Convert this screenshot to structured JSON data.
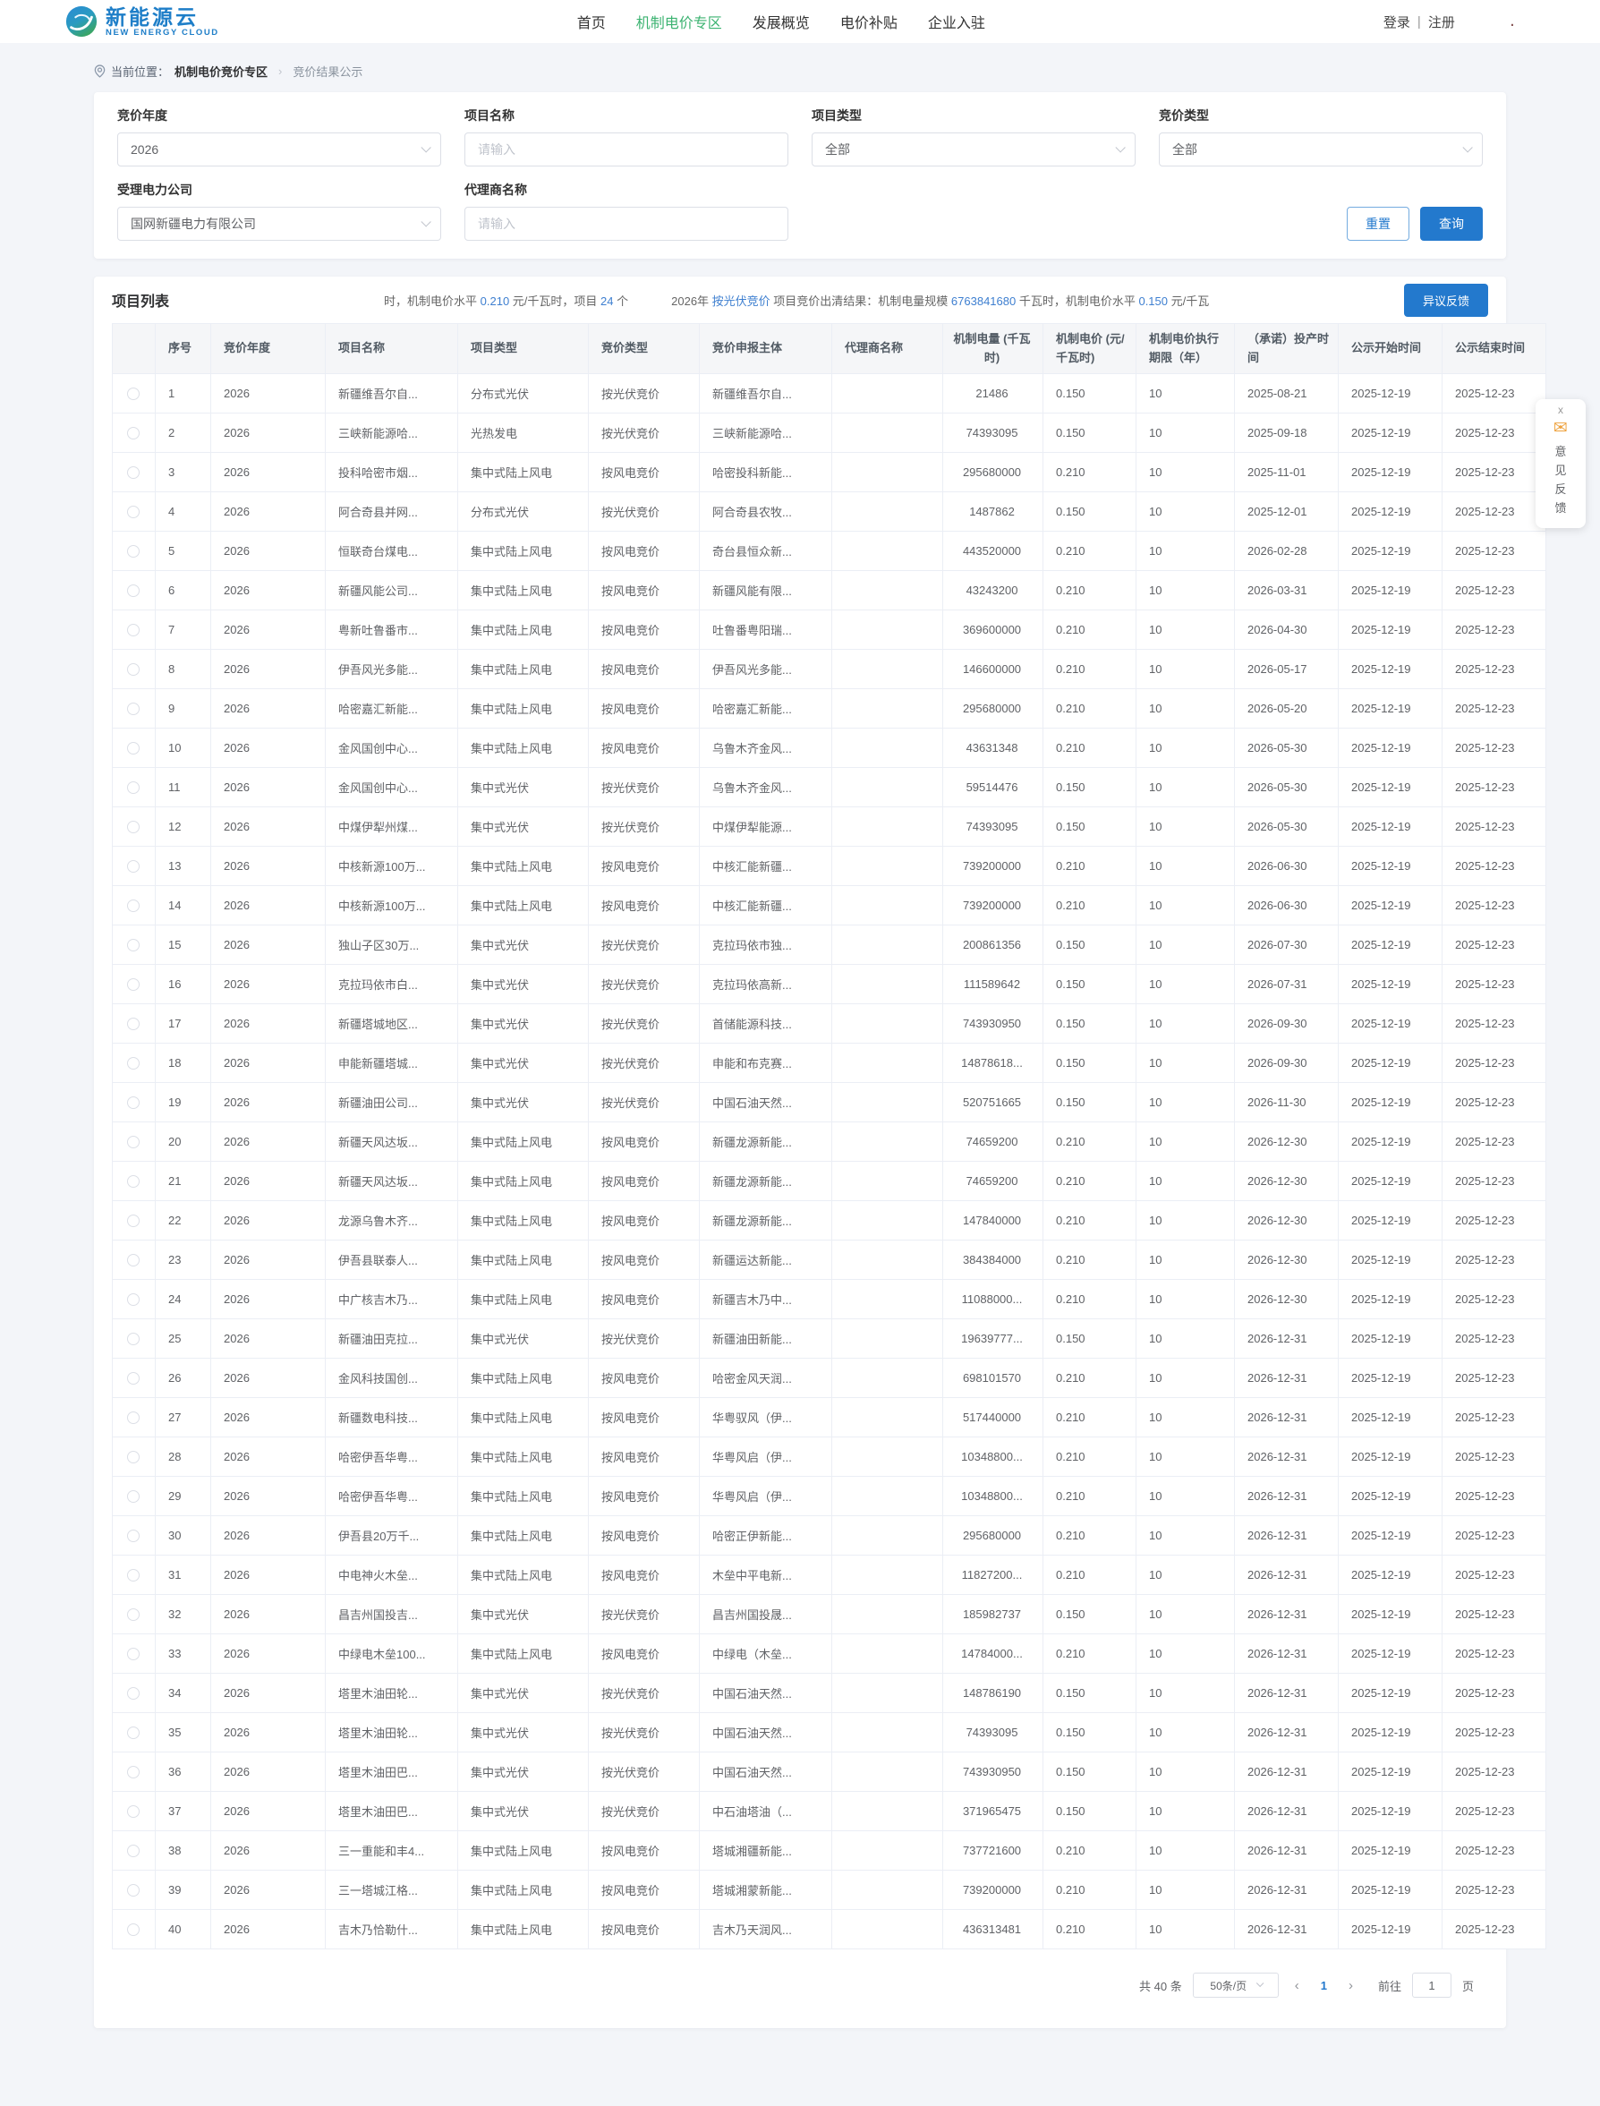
{
  "colors": {
    "accent_blue": "#2379cd",
    "link_blue": "#3e7fd0",
    "active_green": "#3cb371",
    "logo_blue": "#1e7ec8",
    "page_bg": "#f3f5f9"
  },
  "header": {
    "logo_title": "新能源云",
    "logo_subtitle": "NEW ENERGY CLOUD",
    "nav": [
      {
        "key": "home",
        "label": "首页",
        "active": false
      },
      {
        "key": "mechanism-price",
        "label": "机制电价专区",
        "active": true
      },
      {
        "key": "development-overview",
        "label": "发展概览",
        "active": false
      },
      {
        "key": "price-subsidy",
        "label": "电价补贴",
        "active": false
      },
      {
        "key": "enterprise-join",
        "label": "企业入驻",
        "active": false
      }
    ],
    "login_label": "登录",
    "login_divider": "|",
    "register_label": "注册",
    "dot": "."
  },
  "breadcrumb": {
    "label": "当前位置：",
    "root": "机制电价竞价专区",
    "sep": "›",
    "current": "竞价结果公示"
  },
  "filters": {
    "fields": [
      {
        "key": "bidding-year",
        "label": "竞价年度",
        "type": "select",
        "value": "2026"
      },
      {
        "key": "project-name",
        "label": "项目名称",
        "type": "input",
        "value": "",
        "placeholder": "请输入"
      },
      {
        "key": "project-type",
        "label": "项目类型",
        "type": "select",
        "value": "全部"
      },
      {
        "key": "bidding-type",
        "label": "竞价类型",
        "type": "select",
        "value": "全部"
      },
      {
        "key": "power-company",
        "label": "受理电力公司",
        "type": "select",
        "value": "国网新疆电力有限公司"
      },
      {
        "key": "agent-name",
        "label": "代理商名称",
        "type": "input",
        "value": "",
        "placeholder": "请输入"
      }
    ],
    "reset_label": "重置",
    "search_label": "查询"
  },
  "list": {
    "title": "项目列表",
    "feedback_button_label": "异议反馈",
    "ticker_segments": [
      {
        "text": "时，机制电价水平 ",
        "hl": false
      },
      {
        "text": "0.210",
        "hl": true
      },
      {
        "text": " 元/千瓦时，项目 ",
        "hl": false
      },
      {
        "text": "24",
        "hl": true
      },
      {
        "text": " 个",
        "hl": false
      },
      {
        "text": "",
        "gap": true
      },
      {
        "text": "2026年 ",
        "hl": false
      },
      {
        "text": "按光伏竞价",
        "hl": true
      },
      {
        "text": " 项目竞价出清结果：机制电量规模 ",
        "hl": false
      },
      {
        "text": "6763841680",
        "hl": true
      },
      {
        "text": " 千瓦时，机制电价水平 ",
        "hl": false
      },
      {
        "text": "0.150",
        "hl": true
      },
      {
        "text": " 元/千瓦",
        "hl": false
      }
    ],
    "columns": [
      {
        "key": "radio",
        "label": "",
        "width": 48,
        "align": "center"
      },
      {
        "key": "seq",
        "label": "序号",
        "width": 62,
        "align": "left"
      },
      {
        "key": "year",
        "label": "竞价年度",
        "width": 128,
        "align": "left"
      },
      {
        "key": "project-name",
        "label": "项目名称",
        "width": 148,
        "align": "left"
      },
      {
        "key": "project-type",
        "label": "项目类型",
        "width": 146,
        "align": "left"
      },
      {
        "key": "bid-type",
        "label": "竞价类型",
        "width": 124,
        "align": "left"
      },
      {
        "key": "applicant",
        "label": "竞价申报主体",
        "width": 148,
        "align": "left"
      },
      {
        "key": "agent",
        "label": "代理商名称",
        "width": 124,
        "align": "left"
      },
      {
        "key": "energy",
        "label": "机制电量 (千瓦时)",
        "width": 112,
        "align": "center"
      },
      {
        "key": "price",
        "label": "机制电价 (元/千瓦时)",
        "width": 104,
        "align": "left"
      },
      {
        "key": "term",
        "label": "机制电价执行期限（年）",
        "width": 110,
        "align": "left"
      },
      {
        "key": "production-date",
        "label": "（承诺）投产时间",
        "width": 116,
        "align": "left"
      },
      {
        "key": "publicity-start",
        "label": "公示开始时间",
        "width": 116,
        "align": "left"
      },
      {
        "key": "publicity-end",
        "label": "公示结束时间",
        "width": 116,
        "align": "left"
      }
    ],
    "rows": [
      [
        "1",
        "2026",
        "新疆维吾尔自...",
        "分布式光伏",
        "按光伏竞价",
        "新疆维吾尔自...",
        "",
        "21486",
        "0.150",
        "10",
        "2025-08-21",
        "2025-12-19",
        "2025-12-23"
      ],
      [
        "2",
        "2026",
        "三峡新能源哈...",
        "光热发电",
        "按光伏竞价",
        "三峡新能源哈...",
        "",
        "74393095",
        "0.150",
        "10",
        "2025-09-18",
        "2025-12-19",
        "2025-12-23"
      ],
      [
        "3",
        "2026",
        "投科哈密市烟...",
        "集中式陆上风电",
        "按风电竞价",
        "哈密投科新能...",
        "",
        "295680000",
        "0.210",
        "10",
        "2025-11-01",
        "2025-12-19",
        "2025-12-23"
      ],
      [
        "4",
        "2026",
        "阿合奇县并网...",
        "分布式光伏",
        "按光伏竞价",
        "阿合奇县农牧...",
        "",
        "1487862",
        "0.150",
        "10",
        "2025-12-01",
        "2025-12-19",
        "2025-12-23"
      ],
      [
        "5",
        "2026",
        "恒联奇台煤电...",
        "集中式陆上风电",
        "按风电竞价",
        "奇台县恒众新...",
        "",
        "443520000",
        "0.210",
        "10",
        "2026-02-28",
        "2025-12-19",
        "2025-12-23"
      ],
      [
        "6",
        "2026",
        "新疆风能公司...",
        "集中式陆上风电",
        "按风电竞价",
        "新疆风能有限...",
        "",
        "43243200",
        "0.210",
        "10",
        "2026-03-31",
        "2025-12-19",
        "2025-12-23"
      ],
      [
        "7",
        "2026",
        "粤新吐鲁番市...",
        "集中式陆上风电",
        "按风电竞价",
        "吐鲁番粤阳瑞...",
        "",
        "369600000",
        "0.210",
        "10",
        "2026-04-30",
        "2025-12-19",
        "2025-12-23"
      ],
      [
        "8",
        "2026",
        "伊吾风光多能...",
        "集中式陆上风电",
        "按风电竞价",
        "伊吾风光多能...",
        "",
        "146600000",
        "0.210",
        "10",
        "2026-05-17",
        "2025-12-19",
        "2025-12-23"
      ],
      [
        "9",
        "2026",
        "哈密嘉汇新能...",
        "集中式陆上风电",
        "按风电竞价",
        "哈密嘉汇新能...",
        "",
        "295680000",
        "0.210",
        "10",
        "2026-05-20",
        "2025-12-19",
        "2025-12-23"
      ],
      [
        "10",
        "2026",
        "金风国创中心...",
        "集中式陆上风电",
        "按风电竞价",
        "乌鲁木齐金风...",
        "",
        "43631348",
        "0.210",
        "10",
        "2026-05-30",
        "2025-12-19",
        "2025-12-23"
      ],
      [
        "11",
        "2026",
        "金风国创中心...",
        "集中式光伏",
        "按光伏竞价",
        "乌鲁木齐金风...",
        "",
        "59514476",
        "0.150",
        "10",
        "2026-05-30",
        "2025-12-19",
        "2025-12-23"
      ],
      [
        "12",
        "2026",
        "中煤伊犁州煤...",
        "集中式光伏",
        "按光伏竞价",
        "中煤伊犁能源...",
        "",
        "74393095",
        "0.150",
        "10",
        "2026-05-30",
        "2025-12-19",
        "2025-12-23"
      ],
      [
        "13",
        "2026",
        "中核新源100万...",
        "集中式陆上风电",
        "按风电竞价",
        "中核汇能新疆...",
        "",
        "739200000",
        "0.210",
        "10",
        "2026-06-30",
        "2025-12-19",
        "2025-12-23"
      ],
      [
        "14",
        "2026",
        "中核新源100万...",
        "集中式陆上风电",
        "按风电竞价",
        "中核汇能新疆...",
        "",
        "739200000",
        "0.210",
        "10",
        "2026-06-30",
        "2025-12-19",
        "2025-12-23"
      ],
      [
        "15",
        "2026",
        "独山子区30万...",
        "集中式光伏",
        "按光伏竞价",
        "克拉玛依市独...",
        "",
        "200861356",
        "0.150",
        "10",
        "2026-07-30",
        "2025-12-19",
        "2025-12-23"
      ],
      [
        "16",
        "2026",
        "克拉玛依市白...",
        "集中式光伏",
        "按光伏竞价",
        "克拉玛依高新...",
        "",
        "111589642",
        "0.150",
        "10",
        "2026-07-31",
        "2025-12-19",
        "2025-12-23"
      ],
      [
        "17",
        "2026",
        "新疆塔城地区...",
        "集中式光伏",
        "按光伏竞价",
        "首储能源科技...",
        "",
        "743930950",
        "0.150",
        "10",
        "2026-09-30",
        "2025-12-19",
        "2025-12-23"
      ],
      [
        "18",
        "2026",
        "申能新疆塔城...",
        "集中式光伏",
        "按光伏竞价",
        "申能和布克赛...",
        "",
        "14878618...",
        "0.150",
        "10",
        "2026-09-30",
        "2025-12-19",
        "2025-12-23"
      ],
      [
        "19",
        "2026",
        "新疆油田公司...",
        "集中式光伏",
        "按光伏竞价",
        "中国石油天然...",
        "",
        "520751665",
        "0.150",
        "10",
        "2026-11-30",
        "2025-12-19",
        "2025-12-23"
      ],
      [
        "20",
        "2026",
        "新疆天风达坂...",
        "集中式陆上风电",
        "按风电竞价",
        "新疆龙源新能...",
        "",
        "74659200",
        "0.210",
        "10",
        "2026-12-30",
        "2025-12-19",
        "2025-12-23"
      ],
      [
        "21",
        "2026",
        "新疆天风达坂...",
        "集中式陆上风电",
        "按风电竞价",
        "新疆龙源新能...",
        "",
        "74659200",
        "0.210",
        "10",
        "2026-12-30",
        "2025-12-19",
        "2025-12-23"
      ],
      [
        "22",
        "2026",
        "龙源乌鲁木齐...",
        "集中式陆上风电",
        "按风电竞价",
        "新疆龙源新能...",
        "",
        "147840000",
        "0.210",
        "10",
        "2026-12-30",
        "2025-12-19",
        "2025-12-23"
      ],
      [
        "23",
        "2026",
        "伊吾县联泰人...",
        "集中式陆上风电",
        "按风电竞价",
        "新疆运达新能...",
        "",
        "384384000",
        "0.210",
        "10",
        "2026-12-30",
        "2025-12-19",
        "2025-12-23"
      ],
      [
        "24",
        "2026",
        "中广核吉木乃...",
        "集中式陆上风电",
        "按风电竞价",
        "新疆吉木乃中...",
        "",
        "11088000...",
        "0.210",
        "10",
        "2026-12-30",
        "2025-12-19",
        "2025-12-23"
      ],
      [
        "25",
        "2026",
        "新疆油田克拉...",
        "集中式光伏",
        "按光伏竞价",
        "新疆油田新能...",
        "",
        "19639777...",
        "0.150",
        "10",
        "2026-12-31",
        "2025-12-19",
        "2025-12-23"
      ],
      [
        "26",
        "2026",
        "金风科技国创...",
        "集中式陆上风电",
        "按风电竞价",
        "哈密金风天润...",
        "",
        "698101570",
        "0.210",
        "10",
        "2026-12-31",
        "2025-12-19",
        "2025-12-23"
      ],
      [
        "27",
        "2026",
        "新疆数电科技...",
        "集中式陆上风电",
        "按风电竞价",
        "华粤驭风（伊...",
        "",
        "517440000",
        "0.210",
        "10",
        "2026-12-31",
        "2025-12-19",
        "2025-12-23"
      ],
      [
        "28",
        "2026",
        "哈密伊吾华粤...",
        "集中式陆上风电",
        "按风电竞价",
        "华粤风启（伊...",
        "",
        "10348800...",
        "0.210",
        "10",
        "2026-12-31",
        "2025-12-19",
        "2025-12-23"
      ],
      [
        "29",
        "2026",
        "哈密伊吾华粤...",
        "集中式陆上风电",
        "按风电竞价",
        "华粤风启（伊...",
        "",
        "10348800...",
        "0.210",
        "10",
        "2026-12-31",
        "2025-12-19",
        "2025-12-23"
      ],
      [
        "30",
        "2026",
        "伊吾县20万千...",
        "集中式陆上风电",
        "按风电竞价",
        "哈密正伊新能...",
        "",
        "295680000",
        "0.210",
        "10",
        "2026-12-31",
        "2025-12-19",
        "2025-12-23"
      ],
      [
        "31",
        "2026",
        "中电神火木垒...",
        "集中式陆上风电",
        "按风电竞价",
        "木垒中平电新...",
        "",
        "11827200...",
        "0.210",
        "10",
        "2026-12-31",
        "2025-12-19",
        "2025-12-23"
      ],
      [
        "32",
        "2026",
        "昌吉州国投吉...",
        "集中式光伏",
        "按光伏竞价",
        "昌吉州国投晟...",
        "",
        "185982737",
        "0.150",
        "10",
        "2026-12-31",
        "2025-12-19",
        "2025-12-23"
      ],
      [
        "33",
        "2026",
        "中绿电木垒100...",
        "集中式陆上风电",
        "按风电竞价",
        "中绿电（木垒...",
        "",
        "14784000...",
        "0.210",
        "10",
        "2026-12-31",
        "2025-12-19",
        "2025-12-23"
      ],
      [
        "34",
        "2026",
        "塔里木油田轮...",
        "集中式光伏",
        "按光伏竞价",
        "中国石油天然...",
        "",
        "148786190",
        "0.150",
        "10",
        "2026-12-31",
        "2025-12-19",
        "2025-12-23"
      ],
      [
        "35",
        "2026",
        "塔里木油田轮...",
        "集中式光伏",
        "按光伏竞价",
        "中国石油天然...",
        "",
        "74393095",
        "0.150",
        "10",
        "2026-12-31",
        "2025-12-19",
        "2025-12-23"
      ],
      [
        "36",
        "2026",
        "塔里木油田巴...",
        "集中式光伏",
        "按光伏竞价",
        "中国石油天然...",
        "",
        "743930950",
        "0.150",
        "10",
        "2026-12-31",
        "2025-12-19",
        "2025-12-23"
      ],
      [
        "37",
        "2026",
        "塔里木油田巴...",
        "集中式光伏",
        "按光伏竞价",
        "中石油塔油（...",
        "",
        "371965475",
        "0.150",
        "10",
        "2026-12-31",
        "2025-12-19",
        "2025-12-23"
      ],
      [
        "38",
        "2026",
        "三一重能和丰4...",
        "集中式陆上风电",
        "按风电竞价",
        "塔城湘疆新能...",
        "",
        "737721600",
        "0.210",
        "10",
        "2026-12-31",
        "2025-12-19",
        "2025-12-23"
      ],
      [
        "39",
        "2026",
        "三一塔城江格...",
        "集中式陆上风电",
        "按风电竞价",
        "塔城湘蒙新能...",
        "",
        "739200000",
        "0.210",
        "10",
        "2026-12-31",
        "2025-12-19",
        "2025-12-23"
      ],
      [
        "40",
        "2026",
        "吉木乃恰勒什...",
        "集中式陆上风电",
        "按风电竞价",
        "吉木乃天润风...",
        "",
        "436313481",
        "0.210",
        "10",
        "2026-12-31",
        "2025-12-19",
        "2025-12-23"
      ]
    ],
    "pagination": {
      "total": "共 40 条",
      "page_size": "50条/页",
      "prev_icon": "‹",
      "current_page": "1",
      "next_icon": "›",
      "goto_label": "前往",
      "goto_value": "1",
      "goto_suffix": "页"
    }
  },
  "feedback_widget": {
    "close": "x",
    "icon": "✉",
    "label": "意见反馈"
  }
}
